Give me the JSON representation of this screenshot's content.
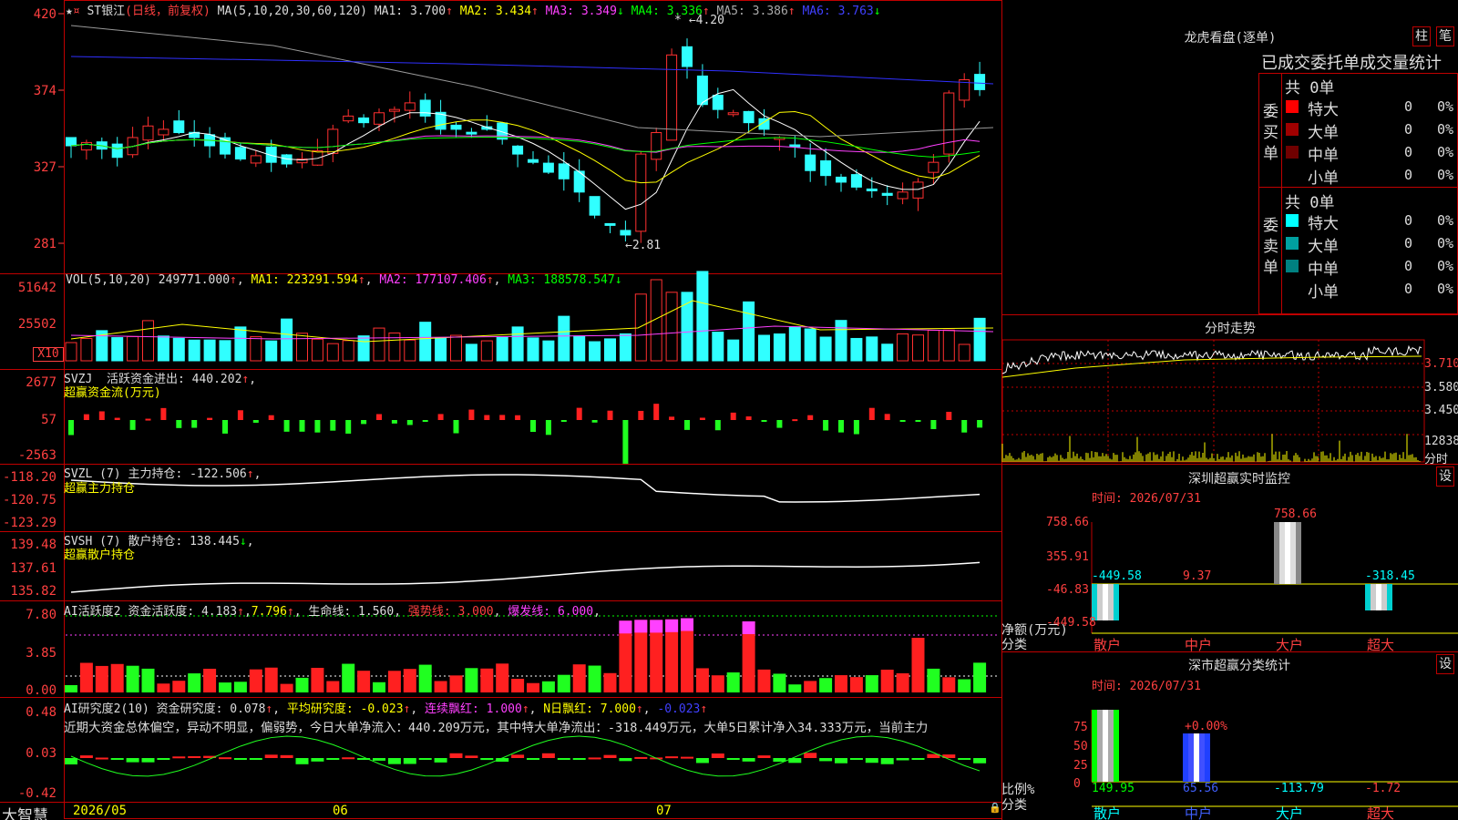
{
  "main": {
    "stock_name": "ST银江",
    "mode": "(日线，前复权)",
    "ma_legend": "MA(5,10,20,30,60,120)",
    "ma": [
      {
        "label": "MA1: 3.700",
        "arrow": "↑",
        "color": "#dddddd"
      },
      {
        "label": "MA2: 3.434",
        "arrow": "↑",
        "color": "#ffff00"
      },
      {
        "label": "MA3: 3.349",
        "arrow": "↓",
        "color": "#ff40ff"
      },
      {
        "label": "MA4: 3.336",
        "arrow": "↑",
        "color": "#00ff00"
      },
      {
        "label": "MA5: 3.386",
        "arrow": "↑",
        "color": "#aaaaaa"
      },
      {
        "label": "MA6: 3.763",
        "arrow": "↓",
        "color": "#4040ff"
      }
    ],
    "y_labels": [
      "420",
      "374",
      "327",
      "281"
    ],
    "hi_label": "4.20",
    "lo_label": "2.81"
  },
  "vol": {
    "legend": "VOL(5,10,20)",
    "value": "249771.000",
    "ma1": "MA1: 223291.594",
    "ma2": "MA2: 177107.406",
    "ma3": "MA3: 188578.547",
    "y_labels": [
      "51642",
      "25502"
    ],
    "unit": "X10"
  },
  "svzj": {
    "name": "SVZJ",
    "label": "活跃资金进出: 440.202",
    "sub": "超赢资金流(万元)",
    "y_labels": [
      "2677",
      "57",
      "-2563"
    ]
  },
  "svzl": {
    "name": "SVZL (7)",
    "label": "主力持仓: -122.506",
    "sub": "超赢主力持仓",
    "y_labels": [
      "-118.20",
      "-120.75",
      "-123.29"
    ]
  },
  "svsh": {
    "name": "SVSH (7)",
    "label": "散户持仓: 138.445",
    "sub": "超赢散户持仓",
    "y_labels": [
      "139.48",
      "137.61",
      "135.82"
    ]
  },
  "ai1": {
    "name": "AI活跃度2",
    "label": "资金活跃度: 4.183",
    "v2": "7.796",
    "life": "生命线: 1.560",
    "strong": "强势线: 3.000",
    "burst": "爆发线: 6.000",
    "y_labels": [
      "7.80",
      "3.85",
      "0.00"
    ]
  },
  "ai2": {
    "name": "AI研究度2(10)",
    "label": "资金研究度: 0.078",
    "avg": "平均研究度: -0.023",
    "cont": "连续飘红: 1.000",
    "nday": "N日飘红: 7.000",
    "extra": "-0.023",
    "comment": "近期大资金总体偏空，异动不明显，偏弱势，今日大单净流入：440.209万元，其中特大单净流出：-318.449万元，大单5日累计净入34.333万元，当前主力",
    "y_labels": [
      "0.48",
      "0.03",
      "-0.42"
    ]
  },
  "xaxis": {
    "brand": "大智慧",
    "labels": [
      "2026/05",
      "06",
      "07"
    ]
  },
  "lhb": {
    "title": "龙虎看盘(逐单)",
    "btn1": "柱",
    "btn2": "笔",
    "header": "已成交委托单成交量统计",
    "buy_side": "委买单",
    "sell_side": "委卖单",
    "buy_total": "共 0单",
    "sell_total": "共 0单",
    "buy_rows": [
      {
        "name": "特大",
        "count": "0",
        "pct": "0%",
        "color": "#ff0000"
      },
      {
        "name": "大单",
        "count": "0",
        "pct": "0%",
        "color": "#a00000"
      },
      {
        "name": "中单",
        "count": "0",
        "pct": "0%",
        "color": "#700000"
      },
      {
        "name": "小单",
        "count": "0",
        "pct": "0%",
        "color": ""
      }
    ],
    "sell_rows": [
      {
        "name": "特大",
        "count": "0",
        "pct": "0%",
        "color": "#00ffff"
      },
      {
        "name": "大单",
        "count": "0",
        "pct": "0%",
        "color": "#00a0a0"
      },
      {
        "name": "中单",
        "count": "0",
        "pct": "0%",
        "color": "#008080"
      },
      {
        "name": "小单",
        "count": "0",
        "pct": "0%",
        "color": ""
      }
    ]
  },
  "fenshi": {
    "title": "分时走势",
    "y_labels": [
      "3.710",
      "3.580",
      "3.450"
    ],
    "vol_label": "12838",
    "unit": "分时"
  },
  "monitor": {
    "title": "深圳超赢实时监控",
    "btn": "设",
    "time": "时间: 2026/07/31",
    "y_labels": [
      "758.66",
      "355.91",
      "-46.83",
      "-449.58"
    ],
    "axis_label": "净额(万元)",
    "axis_label2": "分类",
    "categories": [
      "散户",
      "中户",
      "大户",
      "超大"
    ],
    "values": [
      -449.58,
      9.37,
      758.66,
      -318.45
    ],
    "value_labels": [
      "-449.58",
      "9.37",
      "758.66",
      "-318.45"
    ]
  },
  "stats": {
    "title": "深市超赢分类统计",
    "btn": "设",
    "time": "时间: 2026/07/31",
    "y_labels": [
      "75",
      "50",
      "25",
      "0"
    ],
    "axis_label": "比例%",
    "axis_label2": "分类",
    "pct_label": "+0.00%",
    "categories": [
      "散户",
      "中户",
      "大户",
      "超大"
    ],
    "values": [
      149.95,
      65.56,
      -113.79,
      -1.72
    ],
    "value_labels": [
      "149.95",
      "65.56",
      "-113.79",
      "-1.72"
    ]
  }
}
